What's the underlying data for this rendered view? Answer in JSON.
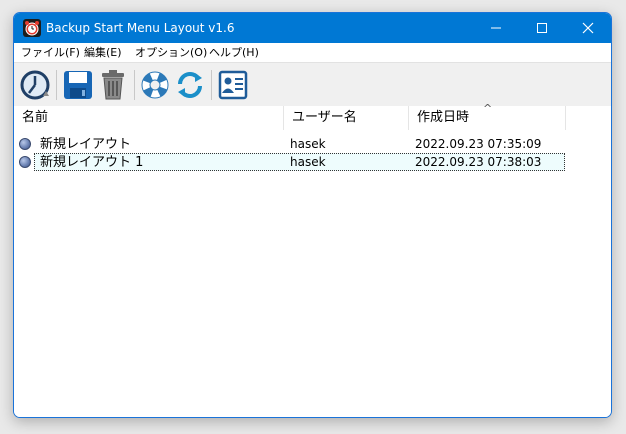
{
  "window": {
    "title": "Backup Start Menu Layout v1.6",
    "accent": "#0078d4"
  },
  "menubar": {
    "items": [
      {
        "label": "ファイル(F)"
      },
      {
        "label": "編集(E)"
      },
      {
        "label": "オプション(O)"
      },
      {
        "label": "ヘルプ(H)"
      }
    ]
  },
  "toolbar": {
    "buttons": [
      {
        "icon": "backup-clock-icon"
      },
      {
        "icon": "save-icon"
      },
      {
        "icon": "trash-icon"
      },
      {
        "icon": "lifebuoy-icon"
      },
      {
        "icon": "refresh-icon"
      },
      {
        "icon": "contact-card-icon"
      }
    ]
  },
  "list": {
    "columns": [
      "名前",
      "ユーザー名",
      "作成日時"
    ],
    "sort_indicator": "^",
    "rows": [
      {
        "name": "新規レイアウト",
        "user": "hasek",
        "date": "2022.09.23 07:35:09",
        "selected": false
      },
      {
        "name": "新規レイアウト 1",
        "user": "hasek",
        "date": "2022.09.23 07:38:03",
        "selected": true
      }
    ]
  }
}
